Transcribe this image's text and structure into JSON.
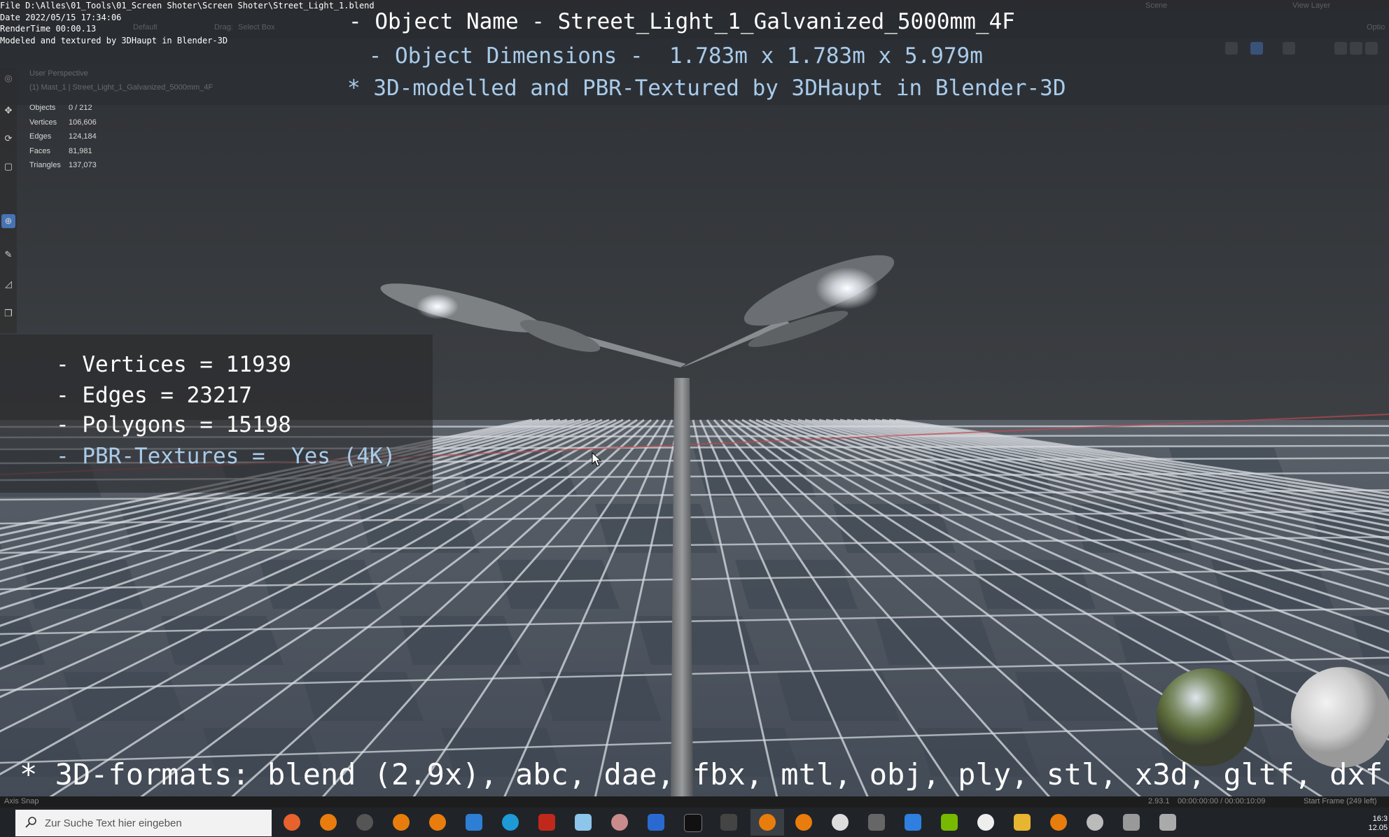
{
  "render_info": {
    "file": "File D:\\Alles\\01_Tools\\01_Screen Shoter\\Screen Shoter\\Street_Light_1.blend",
    "date": "Date 2022/05/15 17:34:06",
    "render_time": "RenderTime 00:00.13",
    "credit": "Modeled and textured by 3DHaupt in Blender-3D"
  },
  "topbar": {
    "orientation": "Default",
    "drag_label": "Drag:",
    "drag_value": "Select Box",
    "scene": "Scene",
    "view_layer": "View Layer",
    "options": "Optio"
  },
  "viewport": {
    "perspective": "User Perspective",
    "object_path": "(1) Mast_1 | Street_Light_1_Galvanized_5000mm_4F",
    "stats": [
      {
        "label": "Objects",
        "value": "0 / 212"
      },
      {
        "label": "Vertices",
        "value": "106,606"
      },
      {
        "label": "Edges",
        "value": "124,184"
      },
      {
        "label": "Faces",
        "value": "81,981"
      },
      {
        "label": "Triangles",
        "value": "137,073"
      }
    ]
  },
  "overlay": {
    "object_name": "- Object Name - Street_Light_1_Galvanized_5000mm_4F",
    "dimensions": " - Object Dimensions -  1.783m x 1.783m x 5.979m",
    "credit_line": "* 3D-modelled and PBR-Textured by 3DHaupt in Blender-3D",
    "vertices": "- Vertices = 11939",
    "edges": "- Edges = 23217",
    "polygons": "- Polygons = 15198",
    "textures": "- PBR-Textures =  Yes (4K)",
    "formats": "* 3D-formats: blend (2.9x), abc, dae, fbx, mtl, obj, ply, stl, x3d, gltf, dxf",
    "accent_color": "#a9cbea"
  },
  "statusbar": {
    "left": "Axis Snap",
    "version": "2.93.1",
    "time": "00:00:00:00 / 00:00:10:09",
    "frame": "Start Frame (249 left)"
  },
  "taskbar": {
    "search_placeholder": "Zur Suche Text hier eingeben",
    "time": "16:3",
    "date": "12.05"
  }
}
